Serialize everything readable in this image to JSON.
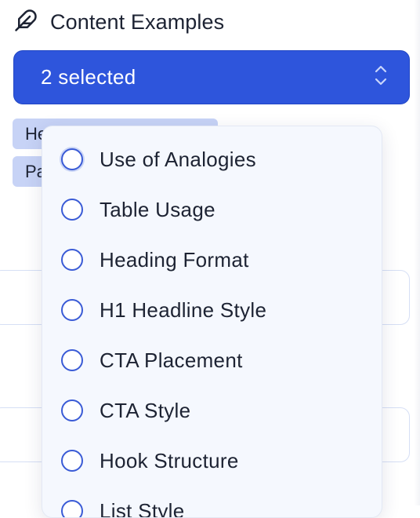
{
  "header": {
    "title": "Content Examples",
    "icon": "feather-icon"
  },
  "select": {
    "value": "2 selected",
    "icon": "chevron-up-down-icon",
    "color": "#2e55dc"
  },
  "chips": [
    {
      "label": "Heading Format"
    },
    {
      "label": "Paragraph"
    }
  ],
  "dropdown": {
    "options": [
      {
        "label": "Use of Analogies"
      },
      {
        "label": "Table Usage"
      },
      {
        "label": "Heading Format"
      },
      {
        "label": "H1 Headline Style"
      },
      {
        "label": "CTA Placement"
      },
      {
        "label": "CTA Style"
      },
      {
        "label": "Hook Structure"
      },
      {
        "label": "List Style"
      }
    ]
  }
}
